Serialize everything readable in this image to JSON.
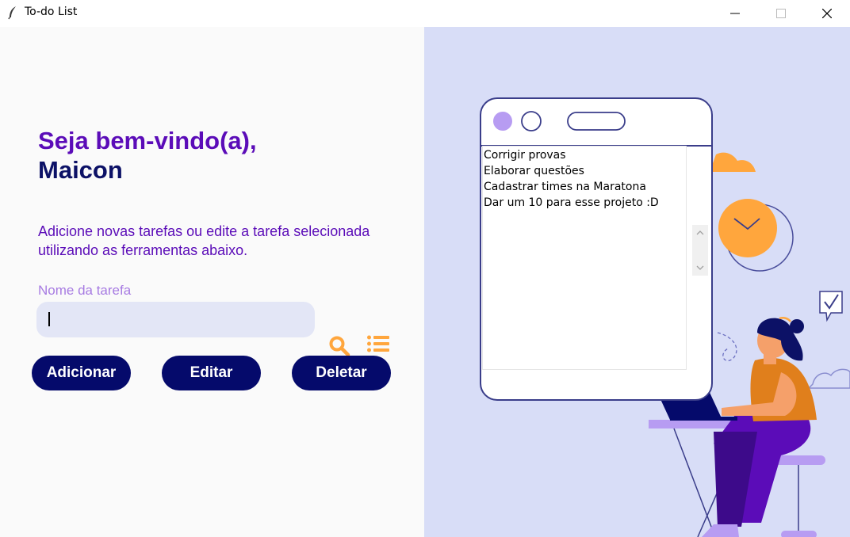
{
  "window": {
    "title": "To-do List"
  },
  "welcome": {
    "line1": "Seja bem-vindo(a),",
    "line2": "Maicon"
  },
  "instructions": "Adicione novas tarefas ou edite a tarefa selecionada utilizando as ferramentas abaixo.",
  "task_field": {
    "label": "Nome da tarefa",
    "value": ""
  },
  "buttons": {
    "add": "Adicionar",
    "edit": "Editar",
    "delete": "Deletar"
  },
  "tasks": [
    "Corrigir provas",
    "Elaborar questões",
    "Cadastrar times na Maratona",
    "Dar um 10 para esse projeto :D"
  ],
  "colors": {
    "accent": "#5b0cb8",
    "navy": "#050a6b",
    "orange": "#ffa63d",
    "panel": "#d8ddf7",
    "input": "#e3e6f6"
  },
  "icons": {
    "search": "search-icon",
    "list": "list-icon",
    "app": "feather-icon"
  }
}
